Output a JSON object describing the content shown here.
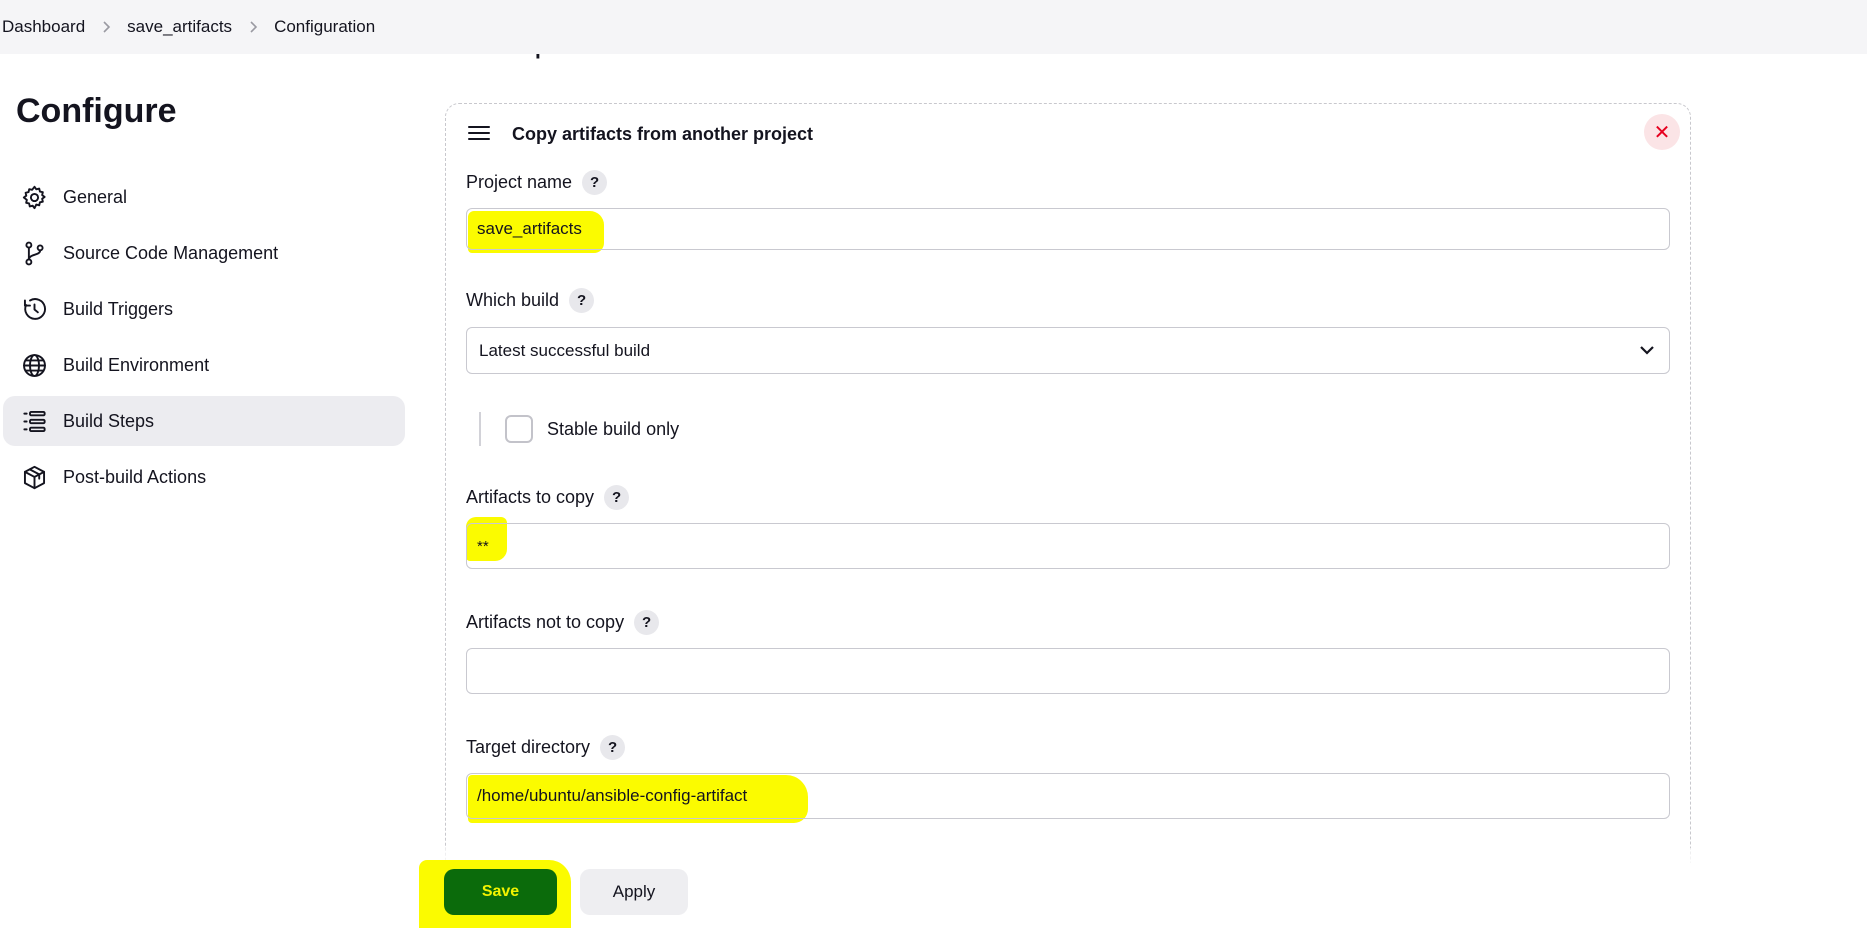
{
  "breadcrumb": {
    "items": [
      "Dashboard",
      "save_artifacts",
      "Configuration"
    ]
  },
  "section_heading": "Build Steps",
  "page": {
    "title": "Configure"
  },
  "sidebar": {
    "items": [
      {
        "label": "General",
        "icon": "gear-icon"
      },
      {
        "label": "Source Code Management",
        "icon": "branch-icon"
      },
      {
        "label": "Build Triggers",
        "icon": "clock-icon"
      },
      {
        "label": "Build Environment",
        "icon": "globe-icon"
      },
      {
        "label": "Build Steps",
        "icon": "list-icon",
        "active": true
      },
      {
        "label": "Post-build Actions",
        "icon": "package-icon"
      }
    ]
  },
  "build_step": {
    "title": "Copy artifacts from another project",
    "close_glyph": "✕",
    "help_glyph": "?",
    "project_name": {
      "label": "Project name",
      "value": "save_artifacts"
    },
    "which_build": {
      "label": "Which build",
      "value": "Latest successful build"
    },
    "stable_only": {
      "label": "Stable build only",
      "checked": false
    },
    "artifacts_to_copy": {
      "label": "Artifacts to copy",
      "value": "**"
    },
    "artifacts_not_to_copy": {
      "label": "Artifacts not to copy",
      "value": ""
    },
    "target_directory": {
      "label": "Target directory",
      "value": "/home/ubuntu/ansible-config-artifact"
    }
  },
  "actions": {
    "save_label": "Save",
    "apply_label": "Apply"
  },
  "colors": {
    "highlight": "#fbfb00",
    "save_bg": "#0b6b0b",
    "close_red": "#e6001f",
    "active_nav_bg": "#ececf0"
  }
}
